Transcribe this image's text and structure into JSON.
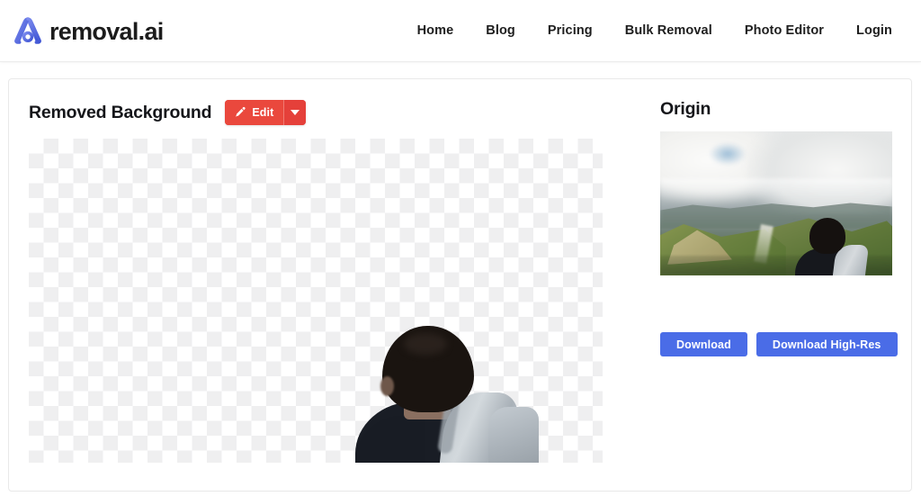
{
  "header": {
    "brand_text": "removal.ai",
    "logo_icon": "removal-ai-logo-icon",
    "logo_color": "#5b6fe0",
    "nav": [
      {
        "label": "Home"
      },
      {
        "label": "Blog"
      },
      {
        "label": "Pricing"
      },
      {
        "label": "Bulk Removal"
      },
      {
        "label": "Photo Editor"
      },
      {
        "label": "Login"
      }
    ]
  },
  "result_pane": {
    "title": "Removed Background",
    "edit_button": {
      "label": "Edit",
      "icon": "pencil-icon",
      "caret_icon": "caret-down-icon",
      "color": "#ea483d"
    },
    "canvas": {
      "alt": "Person seen from behind with shoulder bag strap on transparent checkerboard background",
      "transparency_pattern": "checkerboard",
      "pattern_colors": [
        "#ffffff",
        "#efeff0"
      ]
    }
  },
  "origin_pane": {
    "title": "Origin",
    "thumbnail": {
      "alt": "Person seen from behind looking out over cloudy mountain valley landscape"
    },
    "buttons": [
      {
        "label": "Download",
        "color": "#4a6ce7"
      },
      {
        "label": "Download High-Res",
        "color": "#4a6ce7"
      }
    ]
  }
}
